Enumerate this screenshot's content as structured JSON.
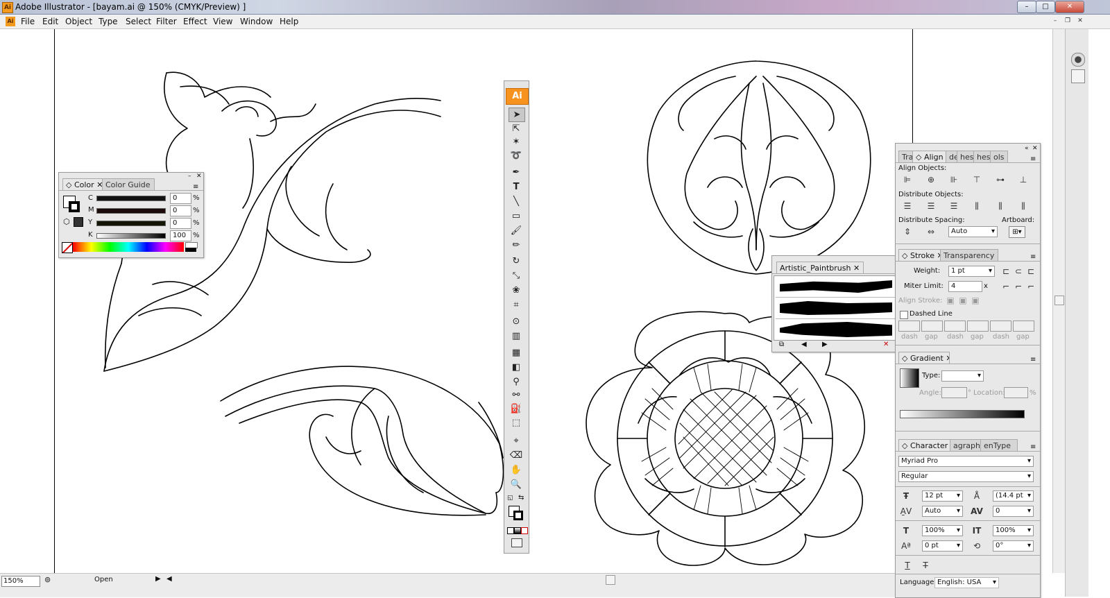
{
  "window": {
    "title": "Adobe Illustrator - [bayam.ai @ 150% (CMYK/Preview) ]",
    "minimize": "–",
    "maximize": "□",
    "close": "✕"
  },
  "menubar": {
    "items": [
      "File",
      "Edit",
      "Object",
      "Type",
      "Select",
      "Filter",
      "Effect",
      "View",
      "Window",
      "Help"
    ]
  },
  "toolbox": {
    "logo": "Ai"
  },
  "color_panel": {
    "tab_color": "Color",
    "tab_guide": "Color Guide",
    "c_label": "C",
    "c_value": "0",
    "m_label": "M",
    "m_value": "0",
    "y_label": "Y",
    "y_value": "0",
    "k_label": "K",
    "k_value": "100",
    "percent": "%"
  },
  "brush_panel": {
    "tab": "Artistic_Paintbrush"
  },
  "align_panel": {
    "tab_transform": "Tra",
    "tab_align": "Align",
    "tab_pathfinder": "der",
    "tab_swatches": "hes",
    "tab_brushes": "hes",
    "tab_symbols": "ols",
    "align_objects": "Align Objects:",
    "distribute_objects": "Distribute Objects:",
    "distribute_spacing": "Distribute Spacing:",
    "artboard": "Artboard:",
    "spacing_value": "Auto"
  },
  "stroke_panel": {
    "tab_stroke": "Stroke",
    "tab_transparency": "Transparency",
    "weight_label": "Weight:",
    "weight_value": "1 pt",
    "miter_label": "Miter Limit:",
    "miter_value": "4",
    "miter_x": "x",
    "align_label": "Align Stroke:",
    "dashed_label": "Dashed Line",
    "dash_labels": [
      "dash",
      "gap",
      "dash",
      "gap",
      "dash",
      "gap"
    ]
  },
  "gradient_panel": {
    "tab": "Gradient",
    "type_label": "Type:",
    "angle_label": "Angle:",
    "degree": "°",
    "location_label": "Location:",
    "percent": "%"
  },
  "character_panel": {
    "tab_character": "Character",
    "tab_paragraph": "agraph",
    "tab_opentype": "enType",
    "font_family": "Myriad Pro",
    "font_style": "Regular",
    "size": "12 pt",
    "leading": "(14.4 pt",
    "kerning": "Auto",
    "tracking": "0",
    "hscale": "100%",
    "vscale": "100%",
    "baseline": "0 pt",
    "rotation": "0°",
    "language_label": "Language:",
    "language_value": "English: USA"
  },
  "statusbar": {
    "zoom": "150%",
    "status": "Open"
  }
}
